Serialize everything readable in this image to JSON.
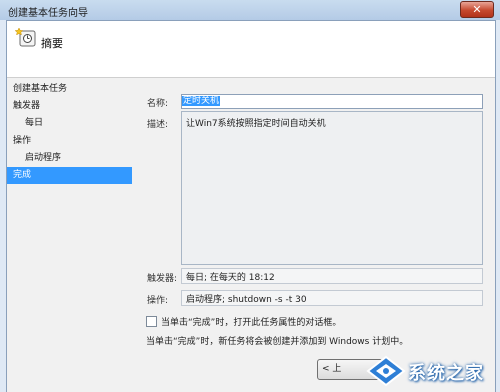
{
  "window": {
    "title": "创建基本任务向导",
    "close_glyph": "✕"
  },
  "header": {
    "title": "摘要",
    "icon": "task-wizard-icon"
  },
  "nav": {
    "items": [
      {
        "label": "创建基本任务",
        "level": "main"
      },
      {
        "label": "触发器",
        "level": "main"
      },
      {
        "label": "每日",
        "level": "sub"
      },
      {
        "label": "操作",
        "level": "main"
      },
      {
        "label": "启动程序",
        "level": "sub"
      },
      {
        "label": "完成",
        "level": "main",
        "selected": true
      }
    ]
  },
  "summary": {
    "name_label": "名称:",
    "name_value": "定时关机",
    "desc_label": "描述:",
    "desc_value": "让Win7系统按照指定时间自动关机",
    "trigger_label": "触发器:",
    "trigger_value": "每日; 在每天的 18:12",
    "action_label": "操作:",
    "action_value": "启动程序; shutdown -s -t 30"
  },
  "checkbox": {
    "label": "当单击“完成”时，打开此任务属性的对话框。",
    "checked": false
  },
  "note": "当单击“完成”时，新任务将会被创建并添加到 Windows 计划中。",
  "buttons": {
    "back": "< 上"
  },
  "watermark": {
    "text": "系统之家"
  },
  "colors": {
    "selection": "#3399ff",
    "close": "#c6492f"
  }
}
